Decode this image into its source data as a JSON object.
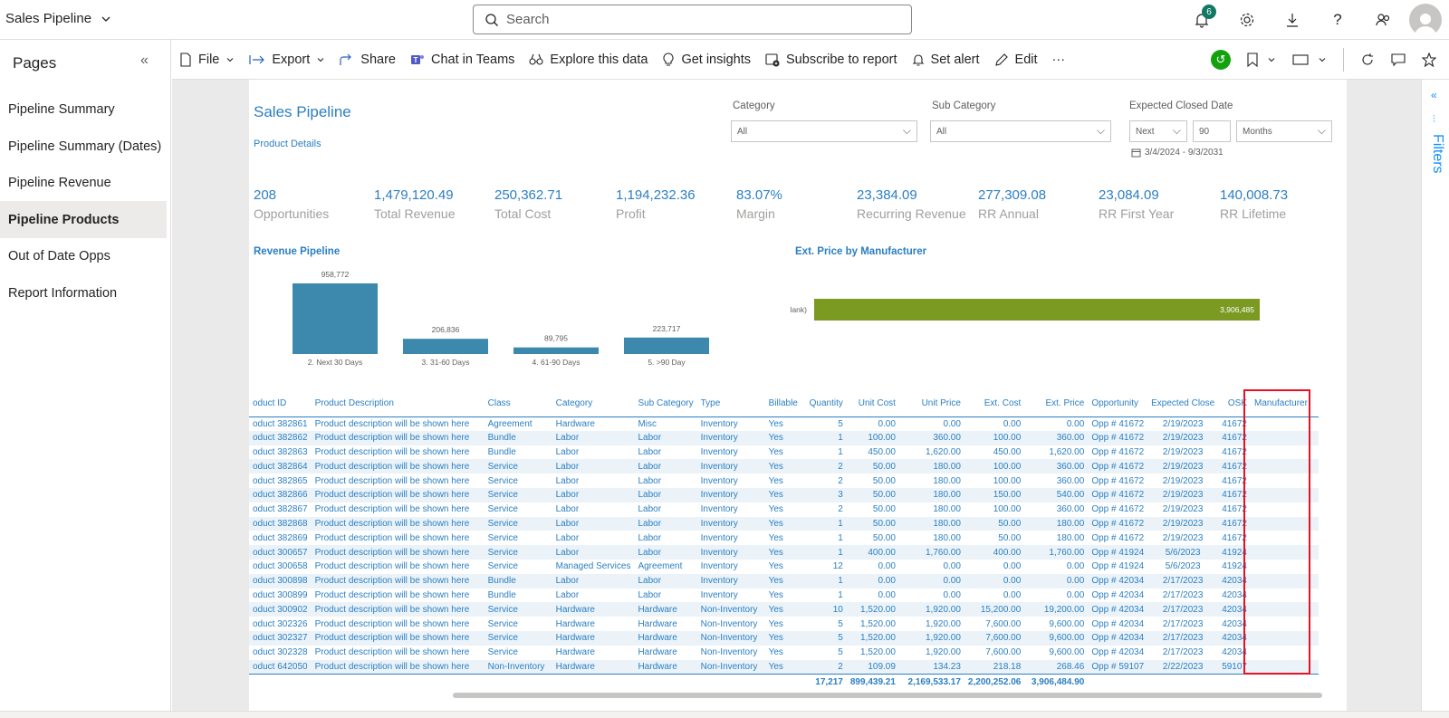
{
  "app": {
    "title": "Sales Pipeline"
  },
  "search": {
    "placeholder": "Search"
  },
  "topbar": {
    "notifications_count": "6"
  },
  "sidebar": {
    "title": "Pages",
    "items": [
      {
        "label": "Pipeline Summary",
        "active": false
      },
      {
        "label": "Pipeline Summary (Dates)",
        "active": false
      },
      {
        "label": "Pipeline Revenue",
        "active": false
      },
      {
        "label": "Pipeline Products",
        "active": true
      },
      {
        "label": "Out of Date Opps",
        "active": false
      },
      {
        "label": "Report Information",
        "active": false
      }
    ]
  },
  "toolbar": {
    "file": "File",
    "export": "Export",
    "share": "Share",
    "chat": "Chat in Teams",
    "explore": "Explore this data",
    "insights": "Get insights",
    "subscribe": "Subscribe to report",
    "alert": "Set alert",
    "edit": "Edit",
    "more": "···"
  },
  "filters_pane": {
    "label": "Filters"
  },
  "report": {
    "title": "Sales Pipeline",
    "subtitle": "Product Details",
    "slicers": {
      "category": {
        "label": "Category",
        "value": "All"
      },
      "subcategory": {
        "label": "Sub Category",
        "value": "All"
      },
      "date": {
        "label": "Expected Closed Date",
        "relative": "Next",
        "count": "90",
        "unit": "Months",
        "range": "3/4/2024 - 9/3/2031"
      }
    },
    "kpis": [
      {
        "value": "208",
        "label": "Opportunities"
      },
      {
        "value": "1,479,120.49",
        "label": "Total Revenue"
      },
      {
        "value": "250,362.71",
        "label": "Total Cost"
      },
      {
        "value": "1,194,232.36",
        "label": "Profit"
      },
      {
        "value": "83.07%",
        "label": "Margin"
      },
      {
        "value": "23,384.09",
        "label": "Recurring Revenue"
      },
      {
        "value": "277,309.08",
        "label": "RR Annual"
      },
      {
        "value": "23,084.09",
        "label": "RR First Year"
      },
      {
        "value": "140,008.73",
        "label": "RR Lifetime"
      }
    ],
    "table": {
      "headers": [
        "oduct ID",
        "Product Description",
        "Class",
        "Category",
        "Sub Category",
        "Type",
        "Billable",
        "Quantity",
        "Unit Cost",
        "Unit Price",
        "Ext. Cost",
        "Ext. Price",
        "Opportunity",
        "Expected Close",
        "OSK",
        "Manufacturer"
      ],
      "rows": [
        [
          "oduct 382861",
          "Product description will be shown here",
          "Agreement",
          "Hardware",
          "Misc",
          "Inventory",
          "Yes",
          "5",
          "0.00",
          "0.00",
          "0.00",
          "0.00",
          "Opp # 41672",
          "2/19/2023",
          "41672",
          ""
        ],
        [
          "oduct 382862",
          "Product description will be shown here",
          "Bundle",
          "Labor",
          "Labor",
          "Inventory",
          "Yes",
          "1",
          "100.00",
          "360.00",
          "100.00",
          "360.00",
          "Opp # 41672",
          "2/19/2023",
          "41672",
          ""
        ],
        [
          "oduct 382863",
          "Product description will be shown here",
          "Bundle",
          "Labor",
          "Labor",
          "Inventory",
          "Yes",
          "1",
          "450.00",
          "1,620.00",
          "450.00",
          "1,620.00",
          "Opp # 41672",
          "2/19/2023",
          "41672",
          ""
        ],
        [
          "oduct 382864",
          "Product description will be shown here",
          "Service",
          "Labor",
          "Labor",
          "Inventory",
          "Yes",
          "2",
          "50.00",
          "180.00",
          "100.00",
          "360.00",
          "Opp # 41672",
          "2/19/2023",
          "41672",
          ""
        ],
        [
          "oduct 382865",
          "Product description will be shown here",
          "Service",
          "Labor",
          "Labor",
          "Inventory",
          "Yes",
          "2",
          "50.00",
          "180.00",
          "100.00",
          "360.00",
          "Opp # 41672",
          "2/19/2023",
          "41672",
          ""
        ],
        [
          "oduct 382866",
          "Product description will be shown here",
          "Service",
          "Labor",
          "Labor",
          "Inventory",
          "Yes",
          "3",
          "50.00",
          "180.00",
          "150.00",
          "540.00",
          "Opp # 41672",
          "2/19/2023",
          "41672",
          ""
        ],
        [
          "oduct 382867",
          "Product description will be shown here",
          "Service",
          "Labor",
          "Labor",
          "Inventory",
          "Yes",
          "2",
          "50.00",
          "180.00",
          "100.00",
          "360.00",
          "Opp # 41672",
          "2/19/2023",
          "41672",
          ""
        ],
        [
          "oduct 382868",
          "Product description will be shown here",
          "Service",
          "Labor",
          "Labor",
          "Inventory",
          "Yes",
          "1",
          "50.00",
          "180.00",
          "50.00",
          "180.00",
          "Opp # 41672",
          "2/19/2023",
          "41672",
          ""
        ],
        [
          "oduct 382869",
          "Product description will be shown here",
          "Service",
          "Labor",
          "Labor",
          "Inventory",
          "Yes",
          "1",
          "50.00",
          "180.00",
          "50.00",
          "180.00",
          "Opp # 41672",
          "2/19/2023",
          "41672",
          ""
        ],
        [
          "oduct 300657",
          "Product description will be shown here",
          "Service",
          "Labor",
          "Labor",
          "Inventory",
          "Yes",
          "1",
          "400.00",
          "1,760.00",
          "400.00",
          "1,760.00",
          "Opp # 41924",
          "5/6/2023",
          "41924",
          ""
        ],
        [
          "oduct 300658",
          "Product description will be shown here",
          "Service",
          "Managed Services",
          "Agreement",
          "Inventory",
          "Yes",
          "12",
          "0.00",
          "0.00",
          "0.00",
          "0.00",
          "Opp # 41924",
          "5/6/2023",
          "41924",
          ""
        ],
        [
          "oduct 300898",
          "Product description will be shown here",
          "Bundle",
          "Labor",
          "Labor",
          "Inventory",
          "Yes",
          "1",
          "0.00",
          "0.00",
          "0.00",
          "0.00",
          "Opp # 42034",
          "2/17/2023",
          "42034",
          ""
        ],
        [
          "oduct 300899",
          "Product description will be shown here",
          "Bundle",
          "Labor",
          "Labor",
          "Inventory",
          "Yes",
          "1",
          "0.00",
          "0.00",
          "0.00",
          "0.00",
          "Opp # 42034",
          "2/17/2023",
          "42034",
          ""
        ],
        [
          "oduct 300902",
          "Product description will be shown here",
          "Service",
          "Hardware",
          "Hardware",
          "Non-Inventory",
          "Yes",
          "10",
          "1,520.00",
          "1,920.00",
          "15,200.00",
          "19,200.00",
          "Opp # 42034",
          "2/17/2023",
          "42034",
          ""
        ],
        [
          "oduct 302326",
          "Product description will be shown here",
          "Service",
          "Hardware",
          "Hardware",
          "Non-Inventory",
          "Yes",
          "5",
          "1,520.00",
          "1,920.00",
          "7,600.00",
          "9,600.00",
          "Opp # 42034",
          "2/17/2023",
          "42034",
          ""
        ],
        [
          "oduct 302327",
          "Product description will be shown here",
          "Service",
          "Hardware",
          "Hardware",
          "Non-Inventory",
          "Yes",
          "5",
          "1,520.00",
          "1,920.00",
          "7,600.00",
          "9,600.00",
          "Opp # 42034",
          "2/17/2023",
          "42034",
          ""
        ],
        [
          "oduct 302328",
          "Product description will be shown here",
          "Service",
          "Hardware",
          "Hardware",
          "Non-Inventory",
          "Yes",
          "5",
          "1,520.00",
          "1,920.00",
          "7,600.00",
          "9,600.00",
          "Opp # 42034",
          "2/17/2023",
          "42034",
          ""
        ],
        [
          "oduct 642050",
          "Product description will be shown here",
          "Non-Inventory",
          "Hardware",
          "Hardware",
          "Non-Inventory",
          "Yes",
          "2",
          "109.09",
          "134.23",
          "218.18",
          "268.46",
          "Opp # 59107",
          "2/22/2023",
          "59107",
          ""
        ]
      ],
      "totals": [
        "",
        "",
        "",
        "",
        "",
        "",
        "",
        "17,217",
        "899,439.21",
        "2,169,533.17",
        "2,200,252.06",
        "3,906,484.90",
        "",
        "",
        "",
        ""
      ]
    }
  },
  "chart_data": [
    {
      "type": "bar",
      "title": "Revenue Pipeline",
      "categories": [
        "2. Next 30 Days",
        "3. 31-60 Days",
        "4. 61-90 Days",
        "5. >90 Day"
      ],
      "values": [
        958772,
        206836,
        89795,
        223717
      ],
      "value_labels": [
        "958,772",
        "206,836",
        "89,795",
        "223,717"
      ],
      "color": "#3d89ae"
    },
    {
      "type": "bar",
      "orientation": "horizontal",
      "title": "Ext. Price by Manufacturer",
      "categories": [
        "(Blank)"
      ],
      "values": [
        3906485
      ],
      "value_labels": [
        "3,906,485"
      ],
      "color": "#7a9a22"
    }
  ]
}
